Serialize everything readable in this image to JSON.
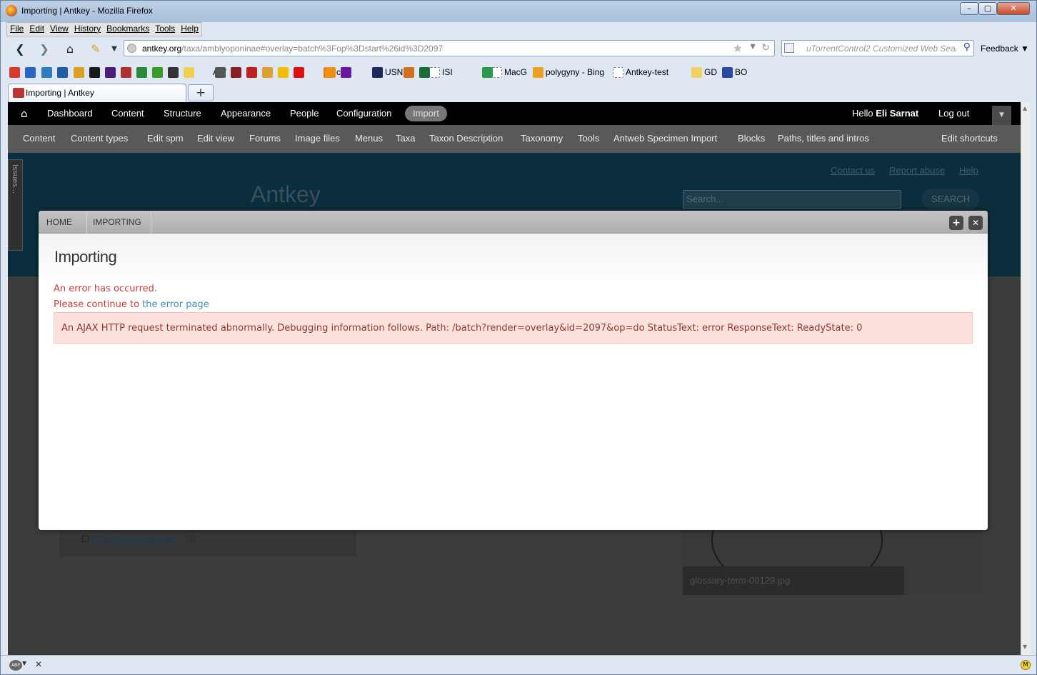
{
  "window": {
    "title": "Importing | Antkey - Mozilla Firefox",
    "controls": {
      "minimize": "–",
      "maximize": "▢",
      "close": "✕"
    }
  },
  "menubar": [
    "File",
    "Edit",
    "View",
    "History",
    "Bookmarks",
    "Tools",
    "Help"
  ],
  "navbar": {
    "url_host": "antkey.org",
    "url_path": "/taxa/amblyoponinae#overlay=batch%3Fop%3Dstart%26id%3D2097",
    "search_placeholder": "uTorrentControl2 Customized Web Search",
    "feedback": "Feedback"
  },
  "bookmarks": [
    {
      "label": "",
      "color": "#d93b2a"
    },
    {
      "label": "",
      "color": "#2a66c8"
    },
    {
      "label": "",
      "color": "#2e7dc2"
    },
    {
      "label": "",
      "color": "#1f5fa8"
    },
    {
      "label": "",
      "color": "#e0a020"
    },
    {
      "label": "",
      "color": "#1a1a1a"
    },
    {
      "label": "",
      "color": "#4a1e7a"
    },
    {
      "label": "",
      "color": "#b03030"
    },
    {
      "label": "",
      "color": "#2a8a3a"
    },
    {
      "label": "",
      "color": "#3a9a2a"
    },
    {
      "label": "",
      "color": "#333333"
    },
    {
      "label": "",
      "color": "#f0d050"
    },
    {
      "label": "AW",
      "color": ""
    },
    {
      "label": "",
      "color": "#555555"
    },
    {
      "label": "",
      "color": "#8a2020"
    },
    {
      "label": "",
      "color": "#c02020"
    },
    {
      "label": "",
      "color": "#e0a030"
    },
    {
      "label": "",
      "color": "#f0c000"
    },
    {
      "label": "",
      "color": "#e01010"
    },
    {
      "label": "cP",
      "color": "#f07020"
    },
    {
      "label": "",
      "color": "#f09010"
    },
    {
      "label": "",
      "color": "#6a1aa0"
    },
    {
      "label": "USNM",
      "color": "#ffffff"
    },
    {
      "label": "",
      "color": "#1a2a5a"
    },
    {
      "label": "ISI",
      "color": "#ffffff"
    },
    {
      "label": "",
      "color": "#d07020"
    },
    {
      "label": "",
      "color": "#1a6a3a"
    },
    {
      "label": "MacG",
      "color": "#ffffff"
    },
    {
      "label": "polygyny - Bing",
      "color": "#f0a020"
    },
    {
      "label": "Antkey-test",
      "color": "#ffffff"
    },
    {
      "label": "",
      "color": "#2a9a4a"
    },
    {
      "label": "GD",
      "color": "#f0d060"
    },
    {
      "label": "BO",
      "color": "#2a4aa0"
    }
  ],
  "tabs": [
    {
      "label": "Importing | Antkey"
    }
  ],
  "newtab": "+",
  "toolbar": {
    "items": [
      "Dashboard",
      "Content",
      "Structure",
      "Appearance",
      "People",
      "Configuration"
    ],
    "active": "Import",
    "greeting": "Hello",
    "user": "Eli Sarnat",
    "logout": "Log out"
  },
  "shortcuts": [
    "Content",
    "Content types",
    "Edit spm",
    "Edit view",
    "Forums",
    "Image files",
    "Menus",
    "Taxa",
    "Taxon Description",
    "Taxonomy",
    "Tools",
    "Antweb Specimen Import",
    "Blocks",
    "Paths, titles and intros"
  ],
  "shortcuts_edit": "Edit shortcuts",
  "site": {
    "name": "Antkey",
    "links": [
      "Contact us",
      "Report abuse",
      "Help"
    ],
    "search_placeholder": "Search...",
    "search_button": "SEARCH",
    "issues_tab": "Issues...",
    "tree_item": "Pseudomyrmecinae",
    "tree_count": "(2)",
    "image_caption": "glossary-term-00129.jpg"
  },
  "overlay": {
    "breadcrumb": [
      "HOME",
      "IMPORTING"
    ],
    "title": "Importing",
    "error": "An error has occurred.",
    "continue_text": "Please continue to",
    "error_link": "the error page",
    "message": "An AJAX HTTP request terminated abnormally. Debugging information follows. Path: /batch?render=overlay&id=2097&op=do StatusText: error ResponseText: ReadyState: 0"
  },
  "statusbar": {
    "abp": "ABP",
    "close": "✕",
    "right_icon": "M"
  }
}
